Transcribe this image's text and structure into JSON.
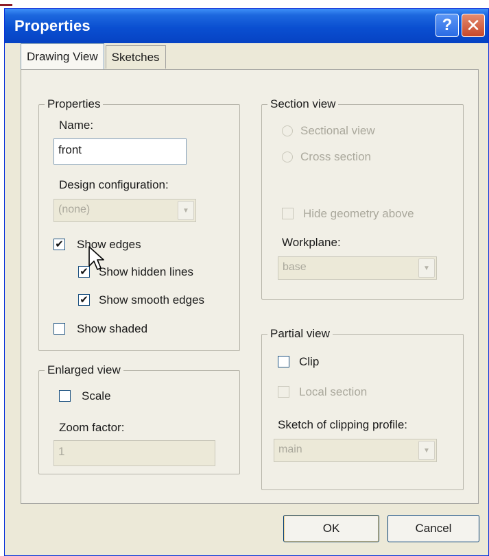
{
  "window": {
    "title": "Properties",
    "help_label": "?",
    "close_label": "✕"
  },
  "tabs": [
    {
      "label": "Drawing View",
      "active": true
    },
    {
      "label": "Sketches",
      "active": false
    }
  ],
  "properties": {
    "legend": "Properties",
    "name_label": "Name:",
    "name_value": "front",
    "design_config_label": "Design configuration:",
    "design_config_value": "(none)",
    "show_edges": {
      "label": "Show edges",
      "checked": true
    },
    "show_hidden_lines": {
      "label": "Show hidden lines",
      "checked": true
    },
    "show_smooth_edges": {
      "label": "Show smooth edges",
      "checked": true
    },
    "show_shaded": {
      "label": "Show shaded",
      "checked": false
    }
  },
  "enlarged_view": {
    "legend": "Enlarged view",
    "scale": {
      "label": "Scale",
      "checked": false
    },
    "zoom_label": "Zoom factor:",
    "zoom_value": "1"
  },
  "section_view": {
    "legend": "Section view",
    "sectional_view_label": "Sectional view",
    "cross_section_label": "Cross section",
    "hide_geometry_label": "Hide geometry above",
    "workplane_label": "Workplane:",
    "workplane_value": "base"
  },
  "partial_view": {
    "legend": "Partial view",
    "clip": {
      "label": "Clip",
      "checked": false
    },
    "local_section_label": "Local section",
    "sketch_label": "Sketch of clipping profile:",
    "sketch_value": "main"
  },
  "buttons": {
    "ok": "OK",
    "cancel": "Cancel"
  },
  "icons": {
    "checkmark": "✔",
    "dropdown": "▼"
  }
}
